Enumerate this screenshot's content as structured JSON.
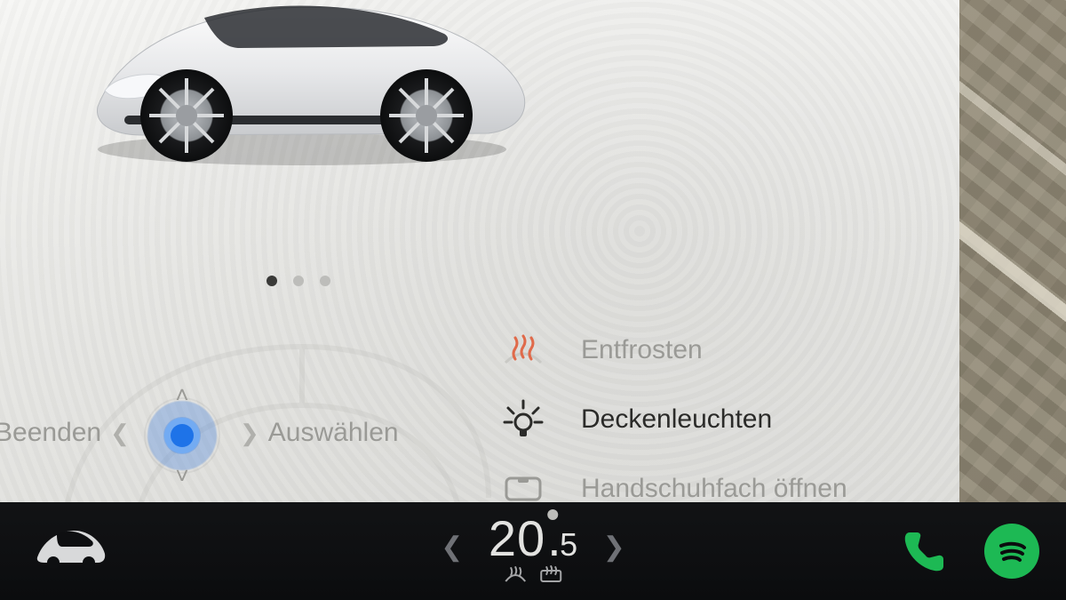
{
  "pager": {
    "count": 3,
    "active_index": 0
  },
  "scroll_hint": {
    "left_label": "Beenden",
    "right_label": "Auswählen"
  },
  "quick_actions": {
    "items": [
      {
        "icon": "defrost-icon",
        "label": "Entfrosten",
        "active": false
      },
      {
        "icon": "dome-light-icon",
        "label": "Deckenleuchten",
        "active": true
      },
      {
        "icon": "glovebox-icon",
        "label": "Handschuhfach öffnen",
        "active": false
      }
    ]
  },
  "dock": {
    "temperature": {
      "whole": "20",
      "decimal": "5"
    },
    "icons": {
      "car": "car-icon",
      "phone": "phone-icon",
      "music": "spotify-icon",
      "defrost_front": "defrost-front-icon",
      "defrost_rear": "defrost-rear-icon"
    },
    "colors": {
      "phone": "#1db954",
      "spotify": "#1db954"
    }
  }
}
